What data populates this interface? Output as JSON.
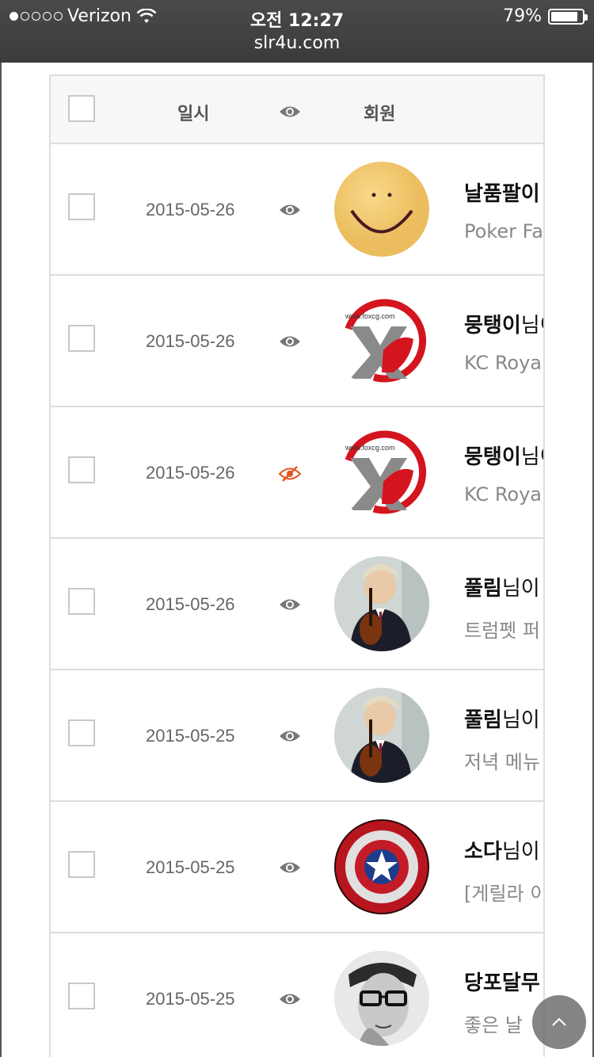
{
  "status_bar": {
    "carrier": "Verizon",
    "time": "오전 12:27",
    "battery": "79%",
    "signal_dots_filled": 1,
    "signal_dots_total": 5
  },
  "url": "slr4u.com",
  "table": {
    "header": {
      "date": "일시",
      "member": "회원"
    },
    "rows": [
      {
        "date": "2015-05-26",
        "eye": "visible",
        "avatar": "smiley",
        "name": "날품팔이",
        "suffix": "",
        "subtitle": "Poker Fa"
      },
      {
        "date": "2015-05-26",
        "eye": "visible",
        "avatar": "foxcg",
        "name": "뭉탱이",
        "suffix": "님이",
        "subtitle": "KC Roya"
      },
      {
        "date": "2015-05-26",
        "eye": "hidden",
        "avatar": "foxcg",
        "name": "뭉탱이",
        "suffix": "님이",
        "subtitle": "KC Roya"
      },
      {
        "date": "2015-05-26",
        "eye": "visible",
        "avatar": "violinist",
        "name": "풀림",
        "suffix": "님이",
        "subtitle": "트럼펫 퍼"
      },
      {
        "date": "2015-05-25",
        "eye": "visible",
        "avatar": "violinist",
        "name": "풀림",
        "suffix": "님이",
        "subtitle": "저녁 메뉴"
      },
      {
        "date": "2015-05-25",
        "eye": "visible",
        "avatar": "shield",
        "name": "소다",
        "suffix": "님이",
        "subtitle": "[게릴라 이"
      },
      {
        "date": "2015-05-25",
        "eye": "visible",
        "avatar": "glasses-man",
        "name": "당포달무",
        "suffix": "",
        "subtitle": "좋은 날"
      }
    ]
  },
  "avatar_text": {
    "foxcg": "www.foxcg.com"
  },
  "colors": {
    "eye_hidden": "#e8541c",
    "eye_visible": "#777777"
  }
}
